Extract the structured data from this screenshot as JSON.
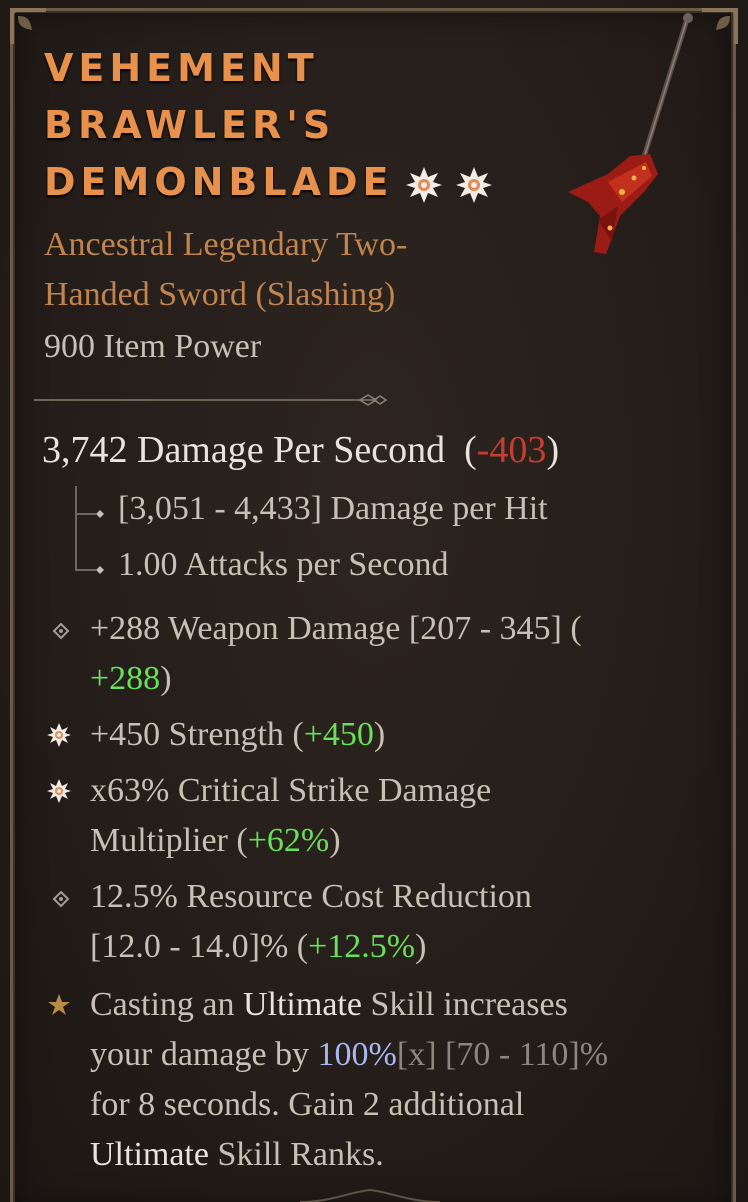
{
  "item": {
    "name_lines": [
      "VEHEMENT",
      "BRAWLER'S",
      "DEMONBLADE"
    ],
    "type_lines": [
      "Ancestral Legendary Two-",
      "Handed Sword (Slashing)"
    ],
    "item_power": "900 Item Power"
  },
  "dps": {
    "main": "3,742 Damage Per Second",
    "open": "(",
    "diff": "-403",
    "close": ")"
  },
  "stats": {
    "per_hit": "[3,051 - 4,433] Damage per Hit",
    "attacks": "1.00 Attacks per Second"
  },
  "affixes": {
    "weapon_damage": {
      "text": "+288 Weapon Damage [207 - 345] (",
      "diff": "+288",
      "close": ")"
    },
    "strength": {
      "text": "+450 Strength (",
      "diff": "+450",
      "close": ")"
    },
    "crit": {
      "line1": "x63% Critical Strike Damage",
      "line2": "Multiplier (",
      "diff": "+62%",
      "close": ")"
    },
    "resource": {
      "line1": "12.5% Resource Cost Reduction",
      "line2": "[12.0 - 14.0]% (",
      "diff": "+12.5%",
      "close": ")"
    }
  },
  "legendary": {
    "l1a": "Casting an ",
    "l1b": "Ultimate",
    "l1c": " Skill increases",
    "l2a": "your damage by ",
    "l2b": "100%",
    "l2c": "[x]",
    "l2d": " [70 - 110]%",
    "l3": "for 8 seconds. Gain 2 additional",
    "l4a": "Ultimate",
    "l4b": " Skill Ranks."
  },
  "colors": {
    "title": "#e7914c",
    "legendary_type": "#c1844f",
    "negative": "#c63c2e",
    "positive": "#67e05a",
    "legendary_text": "#e8974f",
    "highlight_blue": "#a9b8f2"
  },
  "icons": [
    "corner-ornament-icon",
    "greater-affix-star-icon",
    "affix-diamond-icon",
    "legendary-star-icon",
    "two-handed-sword-icon"
  ]
}
